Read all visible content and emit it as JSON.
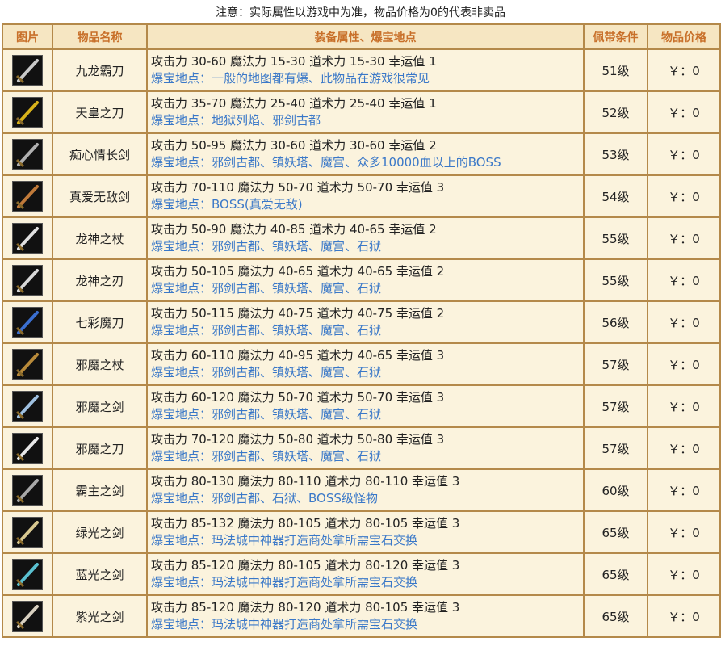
{
  "note": "注意：实际属性以游戏中为准，物品价格为0的代表非卖品",
  "headers": {
    "image": "图片",
    "name": "物品名称",
    "attr": "装备属性、爆宝地点",
    "req": "佩带条件",
    "price": "物品价格"
  },
  "rows": [
    {
      "name": "九龙霸刀",
      "stats": "攻击力 30-60 魔法力 15-30 道术力 15-30 幸运值 1",
      "drop": "爆宝地点：一般的地图都有爆、此物品在游戏很常见",
      "req": "51级",
      "price": "￥：0",
      "icon": "broad-blade-icon",
      "color": "#c9c9c9"
    },
    {
      "name": "天皇之刀",
      "stats": "攻击力 35-70 魔法力 25-40 道术力 25-40 幸运值 1",
      "drop": "爆宝地点：地狱列焰、邪剑古都",
      "req": "52级",
      "price": "￥：0",
      "icon": "golden-blade-icon",
      "color": "#d8b21a"
    },
    {
      "name": "痴心情长剑",
      "stats": "攻击力 50-95 魔法力 30-60 道术力 30-60 幸运值 2",
      "drop": "爆宝地点：邪剑古都、镇妖塔、魔宫、众多10000血以上的BOSS",
      "req": "53级",
      "price": "￥：0",
      "icon": "long-sword-icon",
      "color": "#b0b0b0"
    },
    {
      "name": "真爱无敌剑",
      "stats": "攻击力 70-110 魔法力 50-70 道术力 50-70 幸运值 3",
      "drop": "爆宝地点：BOSS(真爱无敌)",
      "req": "54级",
      "price": "￥：0",
      "icon": "ornate-sword-icon",
      "color": "#c07a3a"
    },
    {
      "name": "龙神之杖",
      "stats": "攻击力 50-90 魔法力 40-85 道术力 40-65 幸运值 2",
      "drop": "爆宝地点：邪剑古都、镇妖塔、魔宫、石狱",
      "req": "55级",
      "price": "￥：0",
      "icon": "dragon-staff-icon",
      "color": "#e0e0e0"
    },
    {
      "name": "龙神之刃",
      "stats": "攻击力 50-105 魔法力 40-65 道术力 40-65 幸运值 2",
      "drop": "爆宝地点：邪剑古都、镇妖塔、魔宫、石狱",
      "req": "55级",
      "price": "￥：0",
      "icon": "dragon-blade-icon",
      "color": "#d8d8d8"
    },
    {
      "name": "七彩魔刀",
      "stats": "攻击力 50-115 魔法力 40-75 道术力 40-75 幸运值 2",
      "drop": "爆宝地点：邪剑古都、镇妖塔、魔宫、石狱",
      "req": "56级",
      "price": "￥：0",
      "icon": "rainbow-blade-icon",
      "color": "#3a6fd0"
    },
    {
      "name": "邪魔之杖",
      "stats": "攻击力 60-110 魔法力 40-95 道术力 40-65 幸运值 3",
      "drop": "爆宝地点：邪剑古都、镇妖塔、魔宫、石狱",
      "req": "57级",
      "price": "￥：0",
      "icon": "demon-staff-icon",
      "color": "#b88a3a"
    },
    {
      "name": "邪魔之剑",
      "stats": "攻击力 60-120 魔法力 50-70 道术力 50-70 幸运值 3",
      "drop": "爆宝地点：邪剑古都、镇妖塔、魔宫、石狱",
      "req": "57级",
      "price": "￥：0",
      "icon": "demon-sword-icon",
      "color": "#9fc0e0"
    },
    {
      "name": "邪魔之刀",
      "stats": "攻击力 70-120 魔法力 50-80 道术力 50-80 幸运值 3",
      "drop": "爆宝地点：邪剑古都、镇妖塔、魔宫、石狱",
      "req": "57级",
      "price": "￥：0",
      "icon": "demon-blade-icon",
      "color": "#e8e8e8"
    },
    {
      "name": "霸主之剑",
      "stats": "攻击力 80-130 魔法力 80-110 道术力 80-110 幸运值 3",
      "drop": "爆宝地点：邪剑古都、石狱、BOSS级怪物",
      "req": "60级",
      "price": "￥：0",
      "icon": "overlord-sword-icon",
      "color": "#a8a8a8"
    },
    {
      "name": "绿光之剑",
      "stats": "攻击力 85-132 魔法力 80-105 道术力 80-105 幸运值 3",
      "drop": "爆宝地点：玛法城中神器打造商处拿所需宝石交换",
      "req": "65级",
      "price": "￥：0",
      "icon": "green-light-sword-icon",
      "color": "#d8c890"
    },
    {
      "name": "蓝光之剑",
      "stats": "攻击力 85-120 魔法力 80-105 道术力 80-120 幸运值 3",
      "drop": "爆宝地点：玛法城中神器打造商处拿所需宝石交换",
      "req": "65级",
      "price": "￥：0",
      "icon": "blue-light-sword-icon",
      "color": "#5ac0d0"
    },
    {
      "name": "紫光之剑",
      "stats": "攻击力 85-120 魔法力 80-120 道术力 80-105 幸运值 3",
      "drop": "爆宝地点：玛法城中神器打造商处拿所需宝石交换",
      "req": "65级",
      "price": "￥：0",
      "icon": "purple-light-sword-icon",
      "color": "#d8d0c0"
    }
  ]
}
